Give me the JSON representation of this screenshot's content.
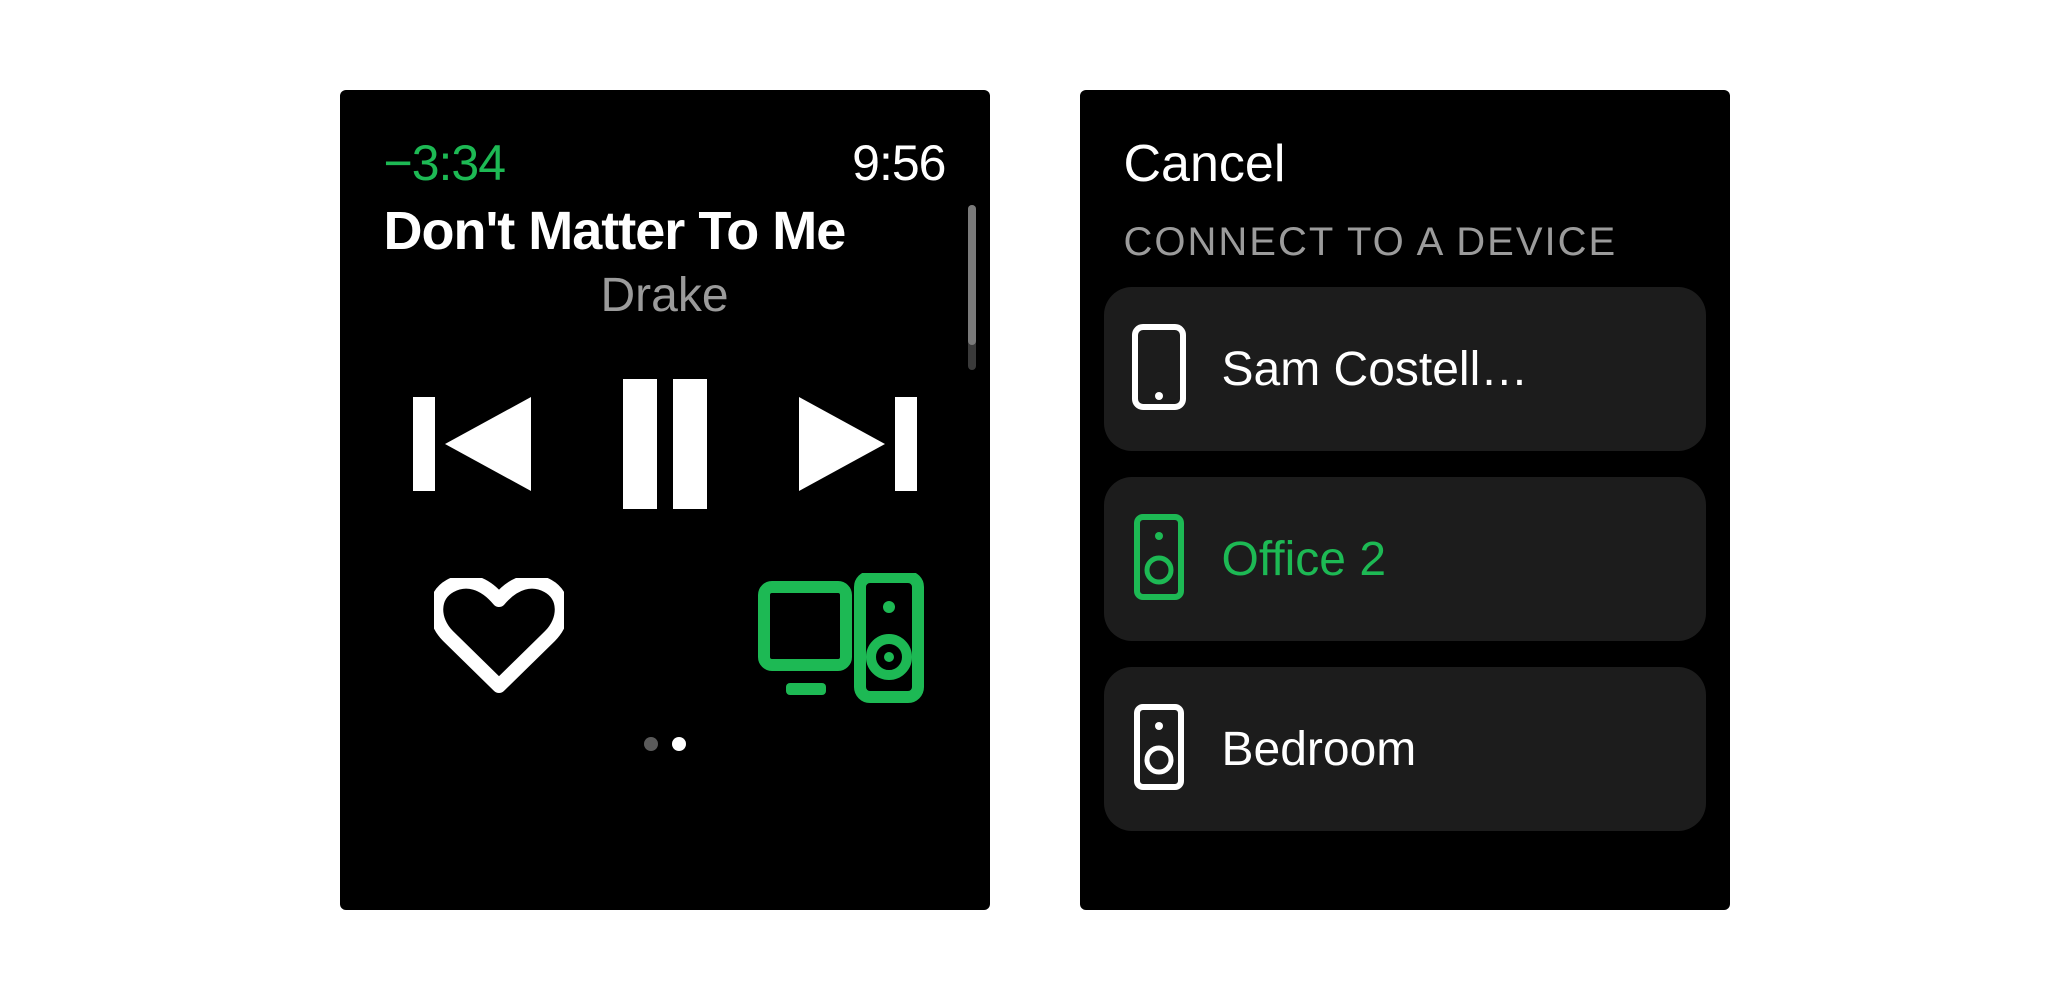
{
  "player": {
    "time_remaining": "−3:34",
    "clock": "9:56",
    "track_title": "Don't Matter To Me",
    "artist": "Drake"
  },
  "device_picker": {
    "cancel_label": "Cancel",
    "section_header": "CONNECT TO A DEVICE",
    "devices": [
      {
        "label": "Sam Costell…",
        "active": false,
        "icon": "phone"
      },
      {
        "label": "Office 2",
        "active": true,
        "icon": "speaker"
      },
      {
        "label": "Bedroom",
        "active": false,
        "icon": "speaker"
      }
    ]
  },
  "colors": {
    "accent": "#1DB954"
  }
}
